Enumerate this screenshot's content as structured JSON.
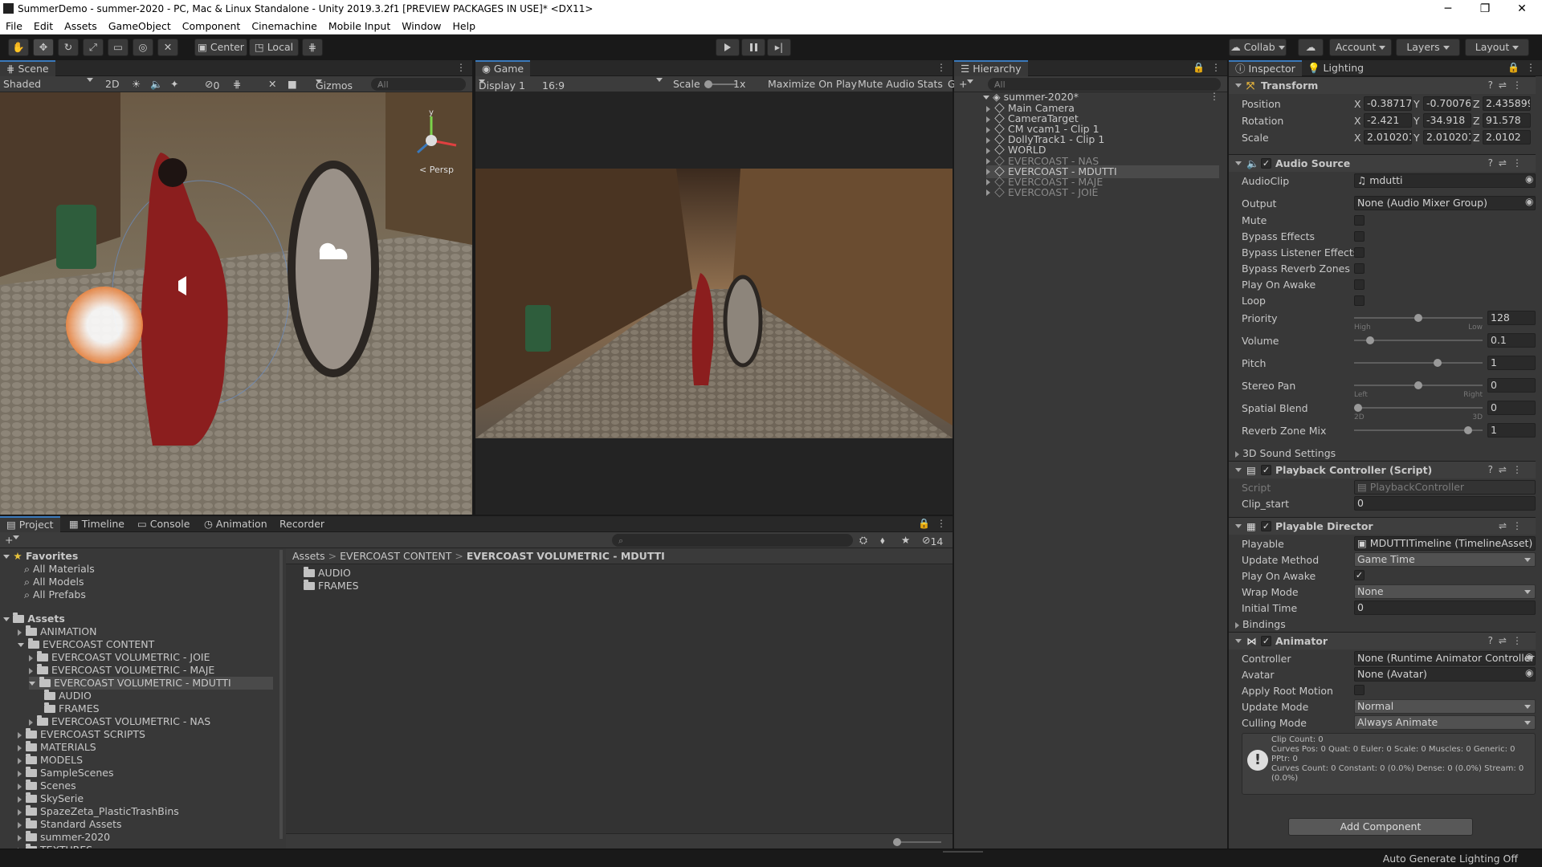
{
  "window": {
    "title": "SummerDemo - summer-2020 - PC, Mac & Linux Standalone - Unity 2019.3.2f1 [PREVIEW PACKAGES IN USE]* <DX11>",
    "controls": [
      "─",
      "❐",
      "✕"
    ]
  },
  "menu": [
    "File",
    "Edit",
    "Assets",
    "GameObject",
    "Component",
    "Cinemachine",
    "Mobile Input",
    "Window",
    "Help"
  ],
  "toolbar": {
    "center": "Center",
    "local": "Local",
    "collab": "Collab",
    "account": "Account",
    "layers": "Layers",
    "layout": "Layout"
  },
  "scene": {
    "tab": "Scene",
    "shading": "Shaded",
    "mode2d": "2D",
    "hidden": "0",
    "gizmos": "Gizmos",
    "search_placeholder": "All",
    "persp": "< Persp"
  },
  "game": {
    "tab": "Game",
    "display": "Display 1",
    "aspect": "16:9",
    "scale_label": "Scale",
    "scale_value": "1x",
    "maximize": "Maximize On Play",
    "mute": "Mute Audio",
    "stats": "Stats",
    "g_cut": "G"
  },
  "hierarchy": {
    "tab": "Hierarchy",
    "search_placeholder": "All",
    "scene_name": "summer-2020*",
    "items": [
      {
        "label": "Main Camera",
        "dim": false
      },
      {
        "label": "CameraTarget",
        "dim": false
      },
      {
        "label": "CM vcam1 - Clip 1",
        "dim": false
      },
      {
        "label": "DollyTrack1 - Clip 1",
        "dim": false
      },
      {
        "label": "WORLD",
        "dim": false
      },
      {
        "label": "EVERCOAST - NAS",
        "dim": true
      },
      {
        "label": "EVERCOAST - MDUTTI",
        "dim": false
      },
      {
        "label": "EVERCOAST - MAJE",
        "dim": true
      },
      {
        "label": "EVERCOAST - JOIE",
        "dim": true
      }
    ]
  },
  "bottom_tabs": [
    "Project",
    "Timeline",
    "Console",
    "Animation",
    "Recorder"
  ],
  "project": {
    "hidden_count": "14",
    "favorites_label": "Favorites",
    "favorites": [
      "All Materials",
      "All Models",
      "All Prefabs"
    ],
    "assets_label": "Assets",
    "tree": [
      {
        "label": "ANIMATION",
        "depth": 1
      },
      {
        "label": "EVERCOAST CONTENT",
        "depth": 1
      },
      {
        "label": "EVERCOAST VOLUMETRIC - JOIE",
        "depth": 2
      },
      {
        "label": "EVERCOAST VOLUMETRIC - MAJE",
        "depth": 2
      },
      {
        "label": "EVERCOAST VOLUMETRIC - MDUTTI",
        "depth": 2
      },
      {
        "label": "AUDIO",
        "depth": 3
      },
      {
        "label": "FRAMES",
        "depth": 3
      },
      {
        "label": "EVERCOAST VOLUMETRIC - NAS",
        "depth": 2
      },
      {
        "label": "EVERCOAST SCRIPTS",
        "depth": 1
      },
      {
        "label": "MATERIALS",
        "depth": 1
      },
      {
        "label": "MODELS",
        "depth": 1
      },
      {
        "label": "SampleScenes",
        "depth": 1
      },
      {
        "label": "Scenes",
        "depth": 1
      },
      {
        "label": "SkySerie",
        "depth": 1
      },
      {
        "label": "SpazeZeta_PlasticTrashBins",
        "depth": 1
      },
      {
        "label": "Standard Assets",
        "depth": 1
      },
      {
        "label": "summer-2020",
        "depth": 1
      },
      {
        "label": "TEXTURES",
        "depth": 1
      }
    ],
    "breadcrumb": [
      "Assets",
      "EVERCOAST CONTENT",
      "EVERCOAST VOLUMETRIC - MDUTTI"
    ],
    "contents": [
      "AUDIO",
      "FRAMES"
    ]
  },
  "inspector": {
    "tab": "Inspector",
    "tab2": "Lighting",
    "transform": {
      "name": "Transform",
      "rows": [
        {
          "label": "Position",
          "x": "-0.38717",
          "y": "-0.70076",
          "z": "2.435899"
        },
        {
          "label": "Rotation",
          "x": "-2.421",
          "y": "-34.918",
          "z": "91.578"
        },
        {
          "label": "Scale",
          "x": "2.010201",
          "y": "2.010201",
          "z": "2.0102"
        }
      ]
    },
    "audio": {
      "name": "Audio Source",
      "clip_label": "AudioClip",
      "clip": "mdutti",
      "output_label": "Output",
      "output": "None (Audio Mixer Group)",
      "toggles": [
        "Mute",
        "Bypass Effects",
        "Bypass Listener Effects",
        "Bypass Reverb Zones",
        "Play On Awake",
        "Loop"
      ],
      "sliders": [
        {
          "label": "Priority",
          "value": "128",
          "pos": 0.5,
          "left": "High",
          "right": "Low"
        },
        {
          "label": "Volume",
          "value": "0.1",
          "pos": 0.1,
          "left": "",
          "right": ""
        },
        {
          "label": "Pitch",
          "value": "1",
          "pos": 0.66,
          "left": "",
          "right": ""
        },
        {
          "label": "Stereo Pan",
          "value": "0",
          "pos": 0.5,
          "left": "Left",
          "right": "Right"
        },
        {
          "label": "Spatial Blend",
          "value": "0",
          "pos": 0.0,
          "left": "2D",
          "right": "3D"
        },
        {
          "label": "Reverb Zone Mix",
          "value": "1",
          "pos": 0.91,
          "left": "",
          "right": ""
        }
      ],
      "sound3d": "3D Sound Settings"
    },
    "playback": {
      "name": "Playback Controller (Script)",
      "script_label": "Script",
      "script": "PlaybackController",
      "clip_label": "Clip_start",
      "clip": "0"
    },
    "director": {
      "name": "Playable Director",
      "playable_label": "Playable",
      "playable": "MDUTTITimeline (TimelineAsset)",
      "update_label": "Update Method",
      "update": "Game Time",
      "awake_label": "Play On Awake",
      "wrap_label": "Wrap Mode",
      "wrap": "None",
      "initial_label": "Initial Time",
      "initial": "0",
      "bindings": "Bindings"
    },
    "animator": {
      "name": "Animator",
      "controller_label": "Controller",
      "controller": "None (Runtime Animator Controller)",
      "avatar_label": "Avatar",
      "avatar": "None (Avatar)",
      "root_label": "Apply Root Motion",
      "update_label": "Update Mode",
      "update": "Normal",
      "culling_label": "Culling Mode",
      "culling": "Always Animate",
      "info": [
        "Clip Count: 0",
        "Curves Pos: 0 Quat: 0 Euler: 0 Scale: 0 Muscles: 0 Generic: 0",
        "PPtr: 0",
        "Curves Count: 0 Constant: 0 (0.0%) Dense: 0 (0.0%) Stream: 0",
        "(0.0%)"
      ]
    },
    "add_component": "Add Component"
  },
  "status": "Auto Generate Lighting Off"
}
